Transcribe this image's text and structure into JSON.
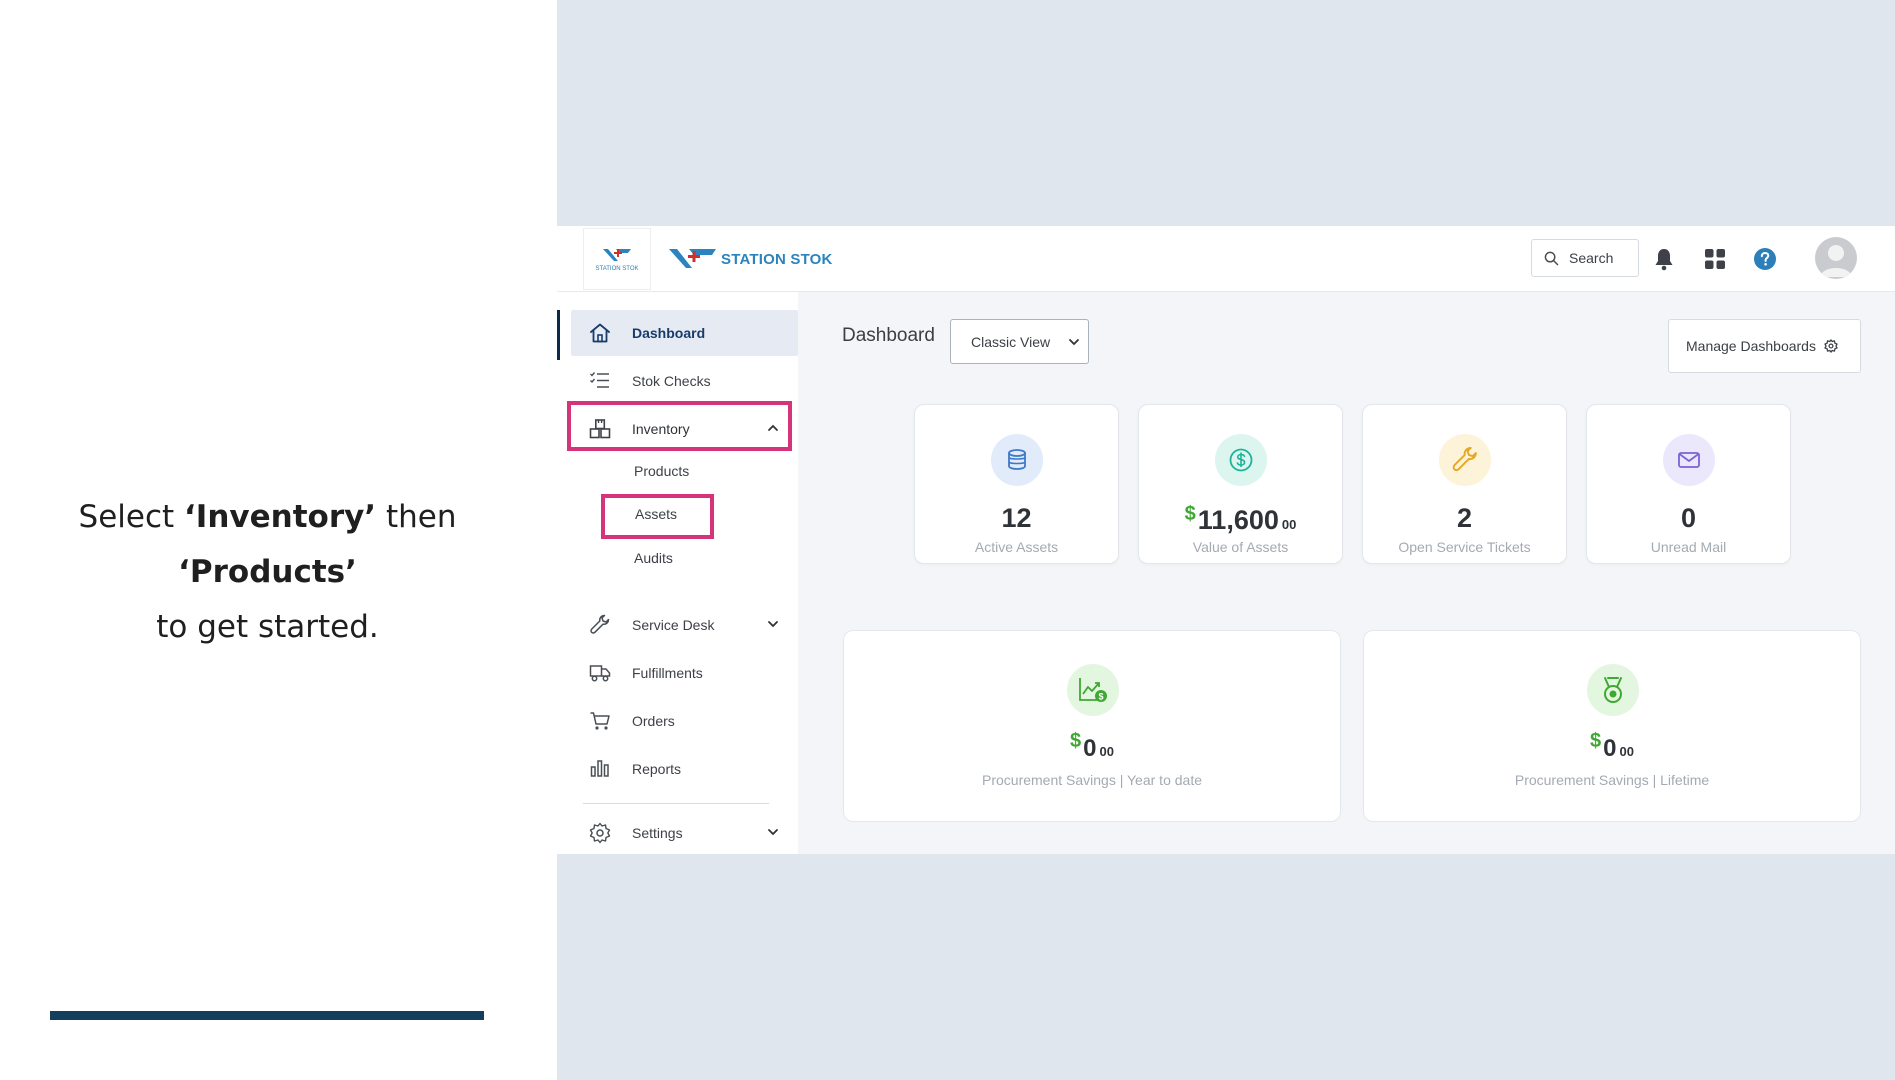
{
  "instruction": {
    "prefix": "Select ",
    "strong1": "‘Inventory’",
    "middle": " then ",
    "strong2": "‘Products’",
    "line2": "to get started."
  },
  "topbar": {
    "brand": "STATION STOK",
    "logo_small_text": "STATION STOK",
    "search_label": "Search",
    "icons": [
      "search-icon",
      "bell-icon",
      "grid-icon",
      "help-icon",
      "avatar"
    ]
  },
  "sidebar": {
    "items": [
      {
        "label": "Dashboard",
        "icon": "home-icon"
      },
      {
        "label": "Stok Checks",
        "icon": "checklist-icon"
      },
      {
        "label": "Inventory",
        "icon": "boxes-icon"
      },
      {
        "label": "Service Desk",
        "icon": "wrench-icon"
      },
      {
        "label": "Fulfillments",
        "icon": "truck-icon"
      },
      {
        "label": "Orders",
        "icon": "cart-icon"
      },
      {
        "label": "Reports",
        "icon": "bar-chart-icon"
      },
      {
        "label": "Settings",
        "icon": "gear-icon"
      }
    ],
    "inventory_sub": [
      "Products",
      "Assets",
      "Audits"
    ]
  },
  "main": {
    "title": "Dashboard",
    "view_select": "Classic View",
    "manage_label": "Manage Dashboards",
    "stats": [
      {
        "value": "12",
        "caption": "Active Assets",
        "color": "#3d79c9"
      },
      {
        "currency": "$",
        "value": "11,600",
        "cents": "00",
        "caption": "Value of Assets",
        "color": "#1fb39a"
      },
      {
        "value": "2",
        "caption": "Open Service Tickets",
        "color": "#e6a823"
      },
      {
        "value": "0",
        "caption": "Unread Mail",
        "color": "#7b62d6"
      }
    ],
    "savings": [
      {
        "currency": "$",
        "value": "0",
        "cents": "00",
        "caption": "Procurement Savings | Year to date"
      },
      {
        "currency": "$",
        "value": "0",
        "cents": "00",
        "caption": "Procurement Savings | Lifetime"
      }
    ]
  },
  "colors": {
    "highlight": "#d6347a",
    "accent_bar": "#143f5c",
    "brand_blue": "#2b84bf",
    "green": "#3fa832"
  }
}
